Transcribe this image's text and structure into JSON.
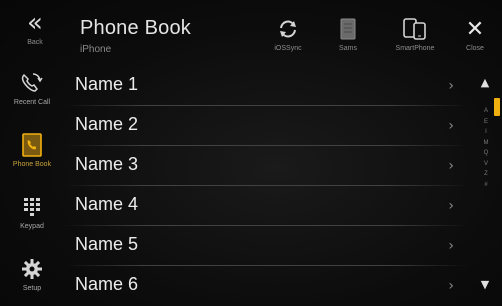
{
  "header": {
    "title": "Phone Book",
    "subtitle": "iPhone",
    "back_label": "Back",
    "sync_label": "iOSSync",
    "phonebook_label": "Sams",
    "smartphone_label": "SmartPhone",
    "close_label": "Close"
  },
  "sidebar": {
    "items": [
      {
        "label": "Recent Call",
        "icon": "recent-call-icon"
      },
      {
        "label": "Phone Book",
        "icon": "phone-book-icon"
      },
      {
        "label": "Keypad",
        "icon": "keypad-icon"
      },
      {
        "label": "Setup",
        "icon": "gear-icon"
      }
    ]
  },
  "contacts": [
    {
      "name": "Name 1"
    },
    {
      "name": "Name 2"
    },
    {
      "name": "Name 3"
    },
    {
      "name": "Name 4"
    },
    {
      "name": "Name 5"
    },
    {
      "name": "Name 6"
    }
  ],
  "index_letters": [
    "A",
    "E",
    "I",
    "M",
    "Q",
    "V",
    "Z",
    "#"
  ],
  "colors": {
    "accent": "#f0b010",
    "text": "#ececec",
    "background": "#0b0b0b"
  }
}
